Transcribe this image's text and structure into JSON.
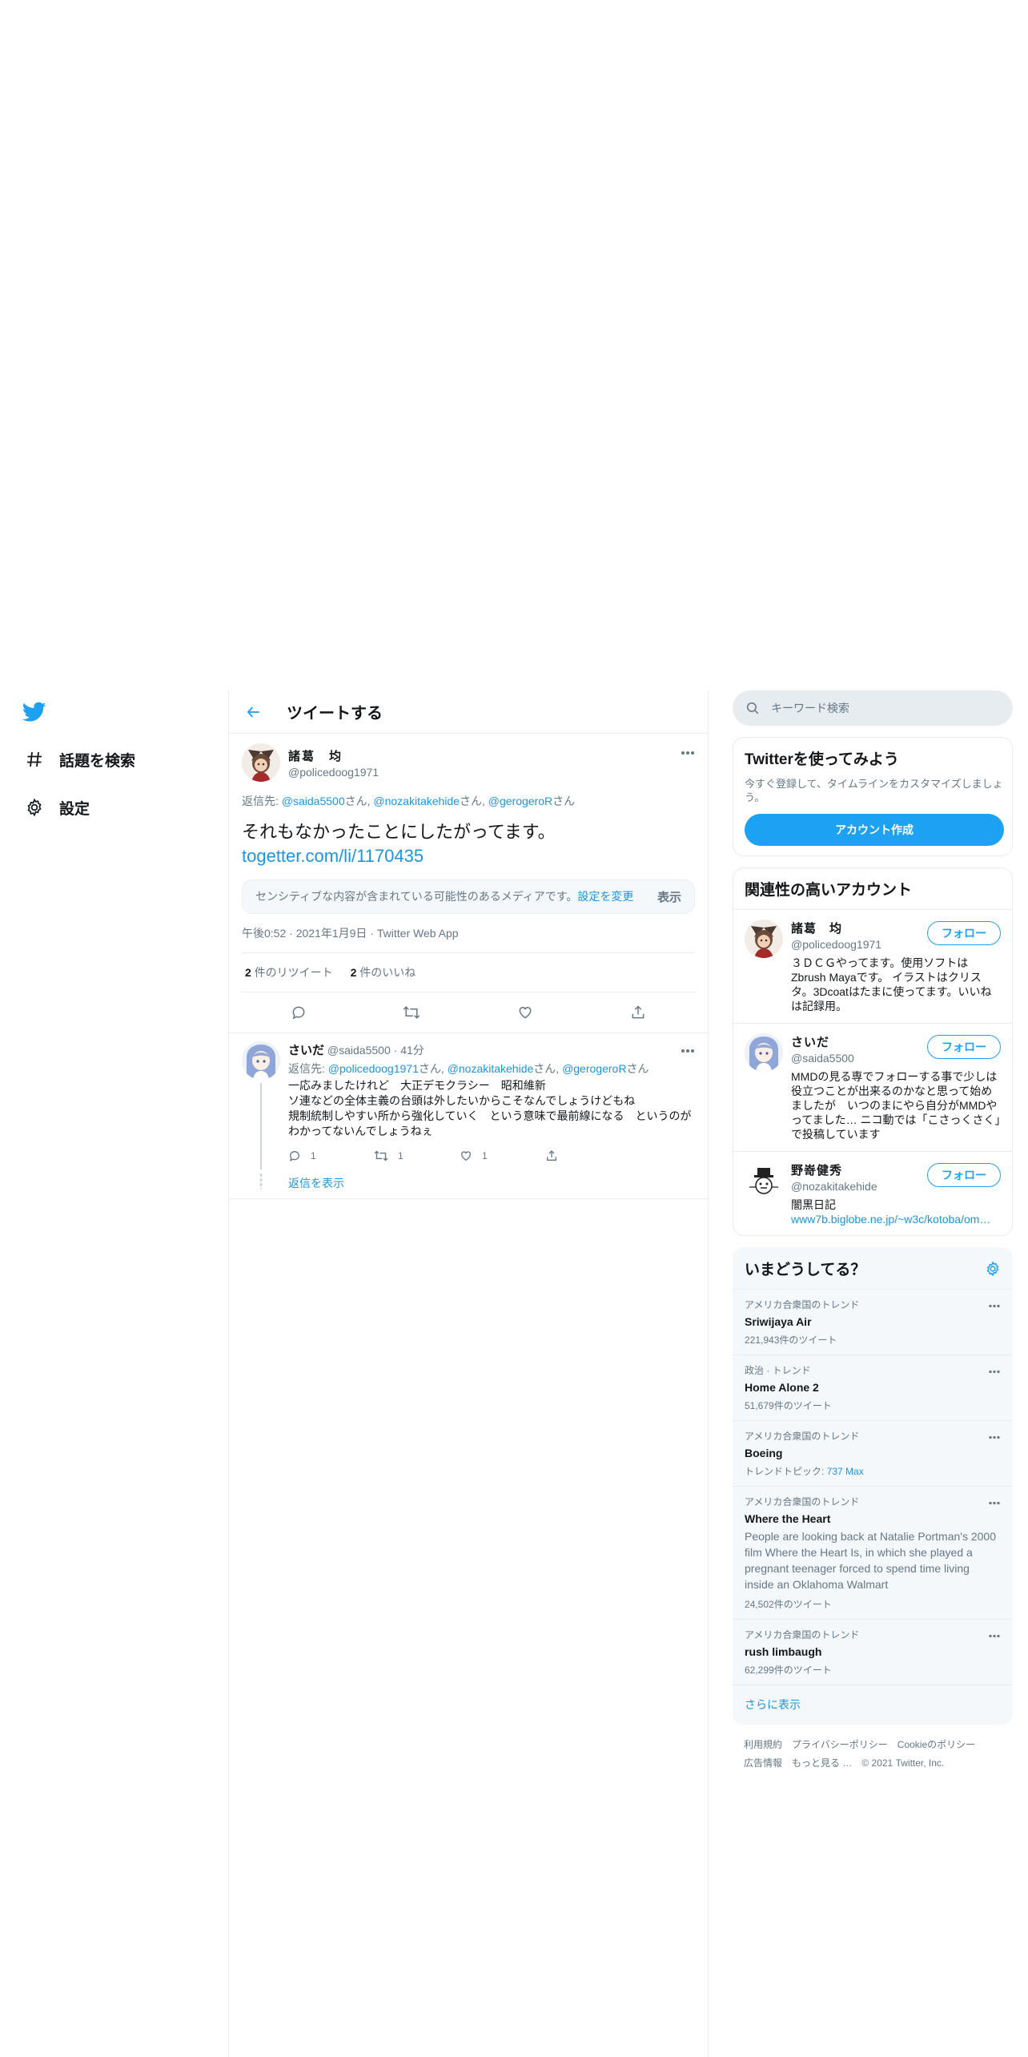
{
  "nav": {
    "items": [
      {
        "label": "話題を検索",
        "icon": "hashtag-icon"
      },
      {
        "label": "設定",
        "icon": "gear-icon"
      }
    ]
  },
  "header": {
    "title": "ツイートする"
  },
  "focus_tweet": {
    "author_name": "諸葛　均",
    "author_handle": "@policedoog1971",
    "reply_prefix": "返信先: ",
    "reply_users": [
      "@saida5500",
      "@nozakitakehide",
      "@gerogeroR"
    ],
    "san": "さん",
    "comma": ", ",
    "text": "それもなかったことにしたがってます。",
    "link": "togetter.com/li/1170435",
    "sensitive_text": "センシティブな内容が含まれている可能性のあるメディアです。",
    "sensitive_link": "設定を変更",
    "sensitive_show": "表示",
    "time": "午後0:52",
    "date": "2021年1月9日",
    "source": "Twitter Web App",
    "sep": " · ",
    "retweet_count": "2",
    "retweet_label": " 件のリツイート",
    "like_count": "2",
    "like_label": " 件のいいね"
  },
  "reply_tweet": {
    "author_name": "さいだ",
    "author_handle": "@saida5500",
    "time_ago": "41分",
    "sep": " · ",
    "reply_prefix": "返信先: ",
    "reply_users": [
      "@policedoog1971",
      "@nozakitakehide",
      "@gerogeroR"
    ],
    "san": "さん",
    "comma": ", ",
    "text": "一応みましたけれど　大正デモクラシー　昭和維新\nソ連などの全体主義の台頭は外したいからこそなんでしょうけどもね\n規制統制しやすい所から強化していく　という意味で最前線になる　というのがわかってないんでしょうねぇ",
    "reply_count": "1",
    "retweet_count": "1",
    "like_count": "1",
    "show_replies": "返信を表示"
  },
  "search": {
    "placeholder": "キーワード検索"
  },
  "signup": {
    "title": "Twitterを使ってみよう",
    "desc": "今すぐ登録して、タイムラインをカスタマイズしましょう。",
    "button": "アカウント作成"
  },
  "related": {
    "title": "関連性の高いアカウント",
    "follow_label": "フォロー",
    "users": [
      {
        "name": "諸葛　均",
        "handle": "@policedoog1971",
        "bio": "３ＤＣＧやってます。使用ソフトはZbrush Mayaです。 イラストはクリスタ。3Dcoatはたまに使ってます。いいねは記録用。",
        "link": ""
      },
      {
        "name": "さいだ",
        "handle": "@saida5500",
        "bio": "MMDの見る専でフォローする事で少しは役立つことが出来るのかなと思って始めましたが　いつのまにやら自分がMMDやってました… ニコ動では「こさっくさく」で投稿しています",
        "link": ""
      },
      {
        "name": "野嵜健秀",
        "handle": "@nozakitakehide",
        "bio": "闇黒日記",
        "link": "www7b.biglobe.ne.jp/~w3c/kotoba/om…"
      }
    ]
  },
  "trends": {
    "title": "いまどうしてる？",
    "items": [
      {
        "context": "アメリカ合衆国のトレンド",
        "name": "Sriwijaya Air",
        "desc": "",
        "count": "221,943件のツイート",
        "count_link": ""
      },
      {
        "context": "政治 · トレンド",
        "name": "Home Alone 2",
        "desc": "",
        "count": "51,679件のツイート",
        "count_link": ""
      },
      {
        "context": "アメリカ合衆国のトレンド",
        "name": "Boeing",
        "desc": "",
        "count": "トレンドトピック: ",
        "count_link": "737 Max"
      },
      {
        "context": "アメリカ合衆国のトレンド",
        "name": "Where the Heart",
        "desc": "People are looking back at Natalie Portman's 2000 film Where the Heart Is, in which she played a pregnant teenager forced to spend time living inside an Oklahoma Walmart",
        "count": "24,502件のツイート",
        "count_link": ""
      },
      {
        "context": "アメリカ合衆国のトレンド",
        "name": "rush limbaugh",
        "desc": "",
        "count": "62,299件のツイート",
        "count_link": ""
      }
    ],
    "show_more": "さらに表示"
  },
  "footer": {
    "links": [
      "利用規約",
      "プライバシーポリシー",
      "Cookieのポリシー",
      "広告情報",
      "もっと見る …"
    ],
    "copyright": "© 2021 Twitter, Inc."
  },
  "colors": {
    "accent": "#1da1f2",
    "link": "#1b95e0",
    "muted": "#657786",
    "border": "#e6ecf0"
  }
}
